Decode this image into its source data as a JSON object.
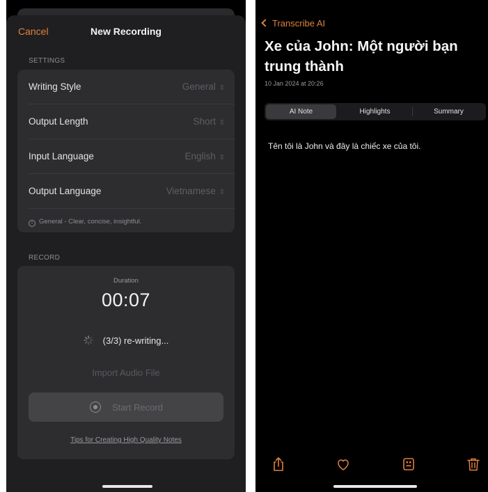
{
  "left": {
    "nav": {
      "cancel_label": "Cancel",
      "title": "New Recording"
    },
    "settings": {
      "section_label": "SETTINGS",
      "rows": [
        {
          "label": "Writing Style",
          "value": "General"
        },
        {
          "label": "Output Length",
          "value": "Short"
        },
        {
          "label": "Input Language",
          "value": "English"
        },
        {
          "label": "Output Language",
          "value": "Vietnamese"
        }
      ],
      "hint": "General - Clear, concise, insightful."
    },
    "record": {
      "section_label": "RECORD",
      "duration_label": "Duration",
      "time": "00:07",
      "status": "(3/3) re-writing...",
      "import_label": "Import Audio File",
      "start_label": "Start Record",
      "tips_label": "Tips for Creating High Quality Notes"
    },
    "colors": {
      "accent": "#e0803e",
      "panel": "#2d2d30",
      "sheet": "#1f1f21"
    }
  },
  "right": {
    "back_label": "Transcribe AI",
    "title": "Xe của John: Một người bạn trung thành",
    "date": "10 Jan 2024 at 20:26",
    "tabs": [
      {
        "label": "AI Note",
        "active": true
      },
      {
        "label": "Highlights",
        "active": false
      },
      {
        "label": "Summary",
        "active": false
      }
    ],
    "note_text": "Tên tôi là John và đây là chiếc xe của tôi.",
    "toolbar": [
      "share-icon",
      "heart-icon",
      "document-icon",
      "trash-icon"
    ],
    "colors": {
      "accent": "#e0803e",
      "background": "#000000"
    }
  }
}
